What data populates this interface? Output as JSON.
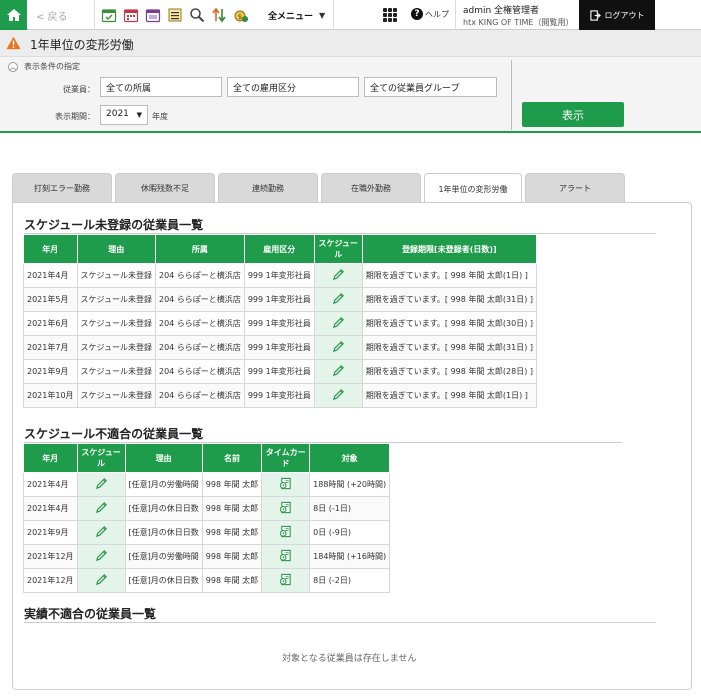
{
  "topbar": {
    "back_label": "< 戻る",
    "menu_label": "全メニュー",
    "help_label": "ヘルプ",
    "user_name": "admin 全権管理者",
    "user_org": "htx KING OF TIME（閲覧用）",
    "logout_label": "ログアウト"
  },
  "page": {
    "title": "1年単位の変形労働"
  },
  "filter": {
    "toggle_label": "表示条件の指定",
    "employee_label": "従業員：",
    "dept_value": "全ての所属",
    "employment_value": "全ての雇用区分",
    "group_value": "全ての従業員グループ",
    "period_label": "表示期間：",
    "year_value": "2021",
    "year_suffix": "年度",
    "show_button": "表示"
  },
  "tabs": [
    {
      "label": "打刻エラー勤務"
    },
    {
      "label": "休暇残数不足"
    },
    {
      "label": "連続勤務"
    },
    {
      "label": "在職外勤務"
    },
    {
      "label": "1年単位の変形労働"
    },
    {
      "label": "アラート"
    }
  ],
  "section1": {
    "title": "スケジュール未登録の従業員一覧",
    "headers": [
      "年月",
      "理由",
      "所属",
      "雇用区分",
      "スケジュール",
      "登録期限[未登録者(日数)]"
    ],
    "rows": [
      [
        "2021年4月",
        "スケジュール未登録",
        "204 ららぽーと横浜店",
        "999 1年変形社員",
        "期限を過ぎています。[ 998 年間 太郎(1日) ]"
      ],
      [
        "2021年5月",
        "スケジュール未登録",
        "204 ららぽーと横浜店",
        "999 1年変形社員",
        "期限を過ぎています。[ 998 年間 太郎(31日) ]"
      ],
      [
        "2021年6月",
        "スケジュール未登録",
        "204 ららぽーと横浜店",
        "999 1年変形社員",
        "期限を過ぎています。[ 998 年間 太郎(30日) ]"
      ],
      [
        "2021年7月",
        "スケジュール未登録",
        "204 ららぽーと横浜店",
        "999 1年変形社員",
        "期限を過ぎています。[ 998 年間 太郎(31日) ]"
      ],
      [
        "2021年9月",
        "スケジュール未登録",
        "204 ららぽーと横浜店",
        "999 1年変形社員",
        "期限を過ぎています。[ 998 年間 太郎(28日) ]"
      ],
      [
        "2021年10月",
        "スケジュール未登録",
        "204 ららぽーと横浜店",
        "999 1年変形社員",
        "期限を過ぎています。[ 998 年間 太郎(1日) ]"
      ]
    ]
  },
  "section2": {
    "title": "スケジュール不適合の従業員一覧",
    "headers": [
      "年月",
      "スケジュール",
      "理由",
      "名前",
      "タイムカード",
      "対象"
    ],
    "rows": [
      [
        "2021年4月",
        "[任意]月の労働時間",
        "998 年間 太郎",
        "188時間 (+20時間)"
      ],
      [
        "2021年4月",
        "[任意]月の休日日数",
        "998 年間 太郎",
        "8日 (-1日)"
      ],
      [
        "2021年9月",
        "[任意]月の休日日数",
        "998 年間 太郎",
        "0日 (-9日)"
      ],
      [
        "2021年12月",
        "[任意]月の労働時間",
        "998 年間 太郎",
        "184時間 (+16時間)"
      ],
      [
        "2021年12月",
        "[任意]月の休日日数",
        "998 年間 太郎",
        "8日 (-2日)"
      ]
    ]
  },
  "section3": {
    "title": "実績不適合の従業員一覧",
    "empty_message": "対象となる従業員は存在しません"
  },
  "colors": {
    "brand": "#1e9c4b",
    "warning": "#e8741c"
  }
}
